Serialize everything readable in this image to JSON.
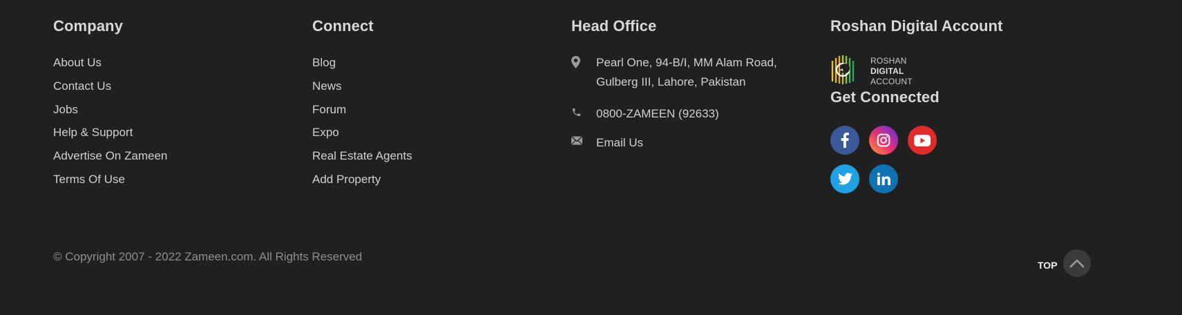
{
  "company": {
    "heading": "Company",
    "links": [
      "About Us",
      "Contact Us",
      "Jobs",
      "Help & Support",
      "Advertise On Zameen",
      "Terms Of Use"
    ]
  },
  "connect": {
    "heading": "Connect",
    "links": [
      "Blog",
      "News",
      "Forum",
      "Expo",
      "Real Estate Agents",
      "Add Property"
    ]
  },
  "office": {
    "heading": "Head Office",
    "address_line1": "Pearl One, 94-B/I, MM Alam Road,",
    "address_line2": "Gulberg III, Lahore, Pakistan",
    "phone": "0800-ZAMEEN (92633)",
    "email_label": "Email Us",
    "icons": [
      "location-pin-icon",
      "phone-icon",
      "envelope-icon"
    ]
  },
  "rda": {
    "heading": "Roshan Digital Account",
    "logo_line1": "ROSHAN",
    "logo_line2": "DIGITAL",
    "logo_line3": "ACCOUNT"
  },
  "social": {
    "heading": "Get Connected",
    "networks": [
      "facebook",
      "instagram",
      "youtube",
      "twitter",
      "linkedin"
    ]
  },
  "footer": {
    "copyright": "© Copyright 2007 - 2022 Zameen.com. All Rights Reserved",
    "top_label": "TOP"
  },
  "colors": {
    "background": "#202020",
    "facebook": "#3b5998",
    "youtube": "#e02b2b",
    "twitter": "#1fa1e3",
    "linkedin": "#0f73b2"
  }
}
